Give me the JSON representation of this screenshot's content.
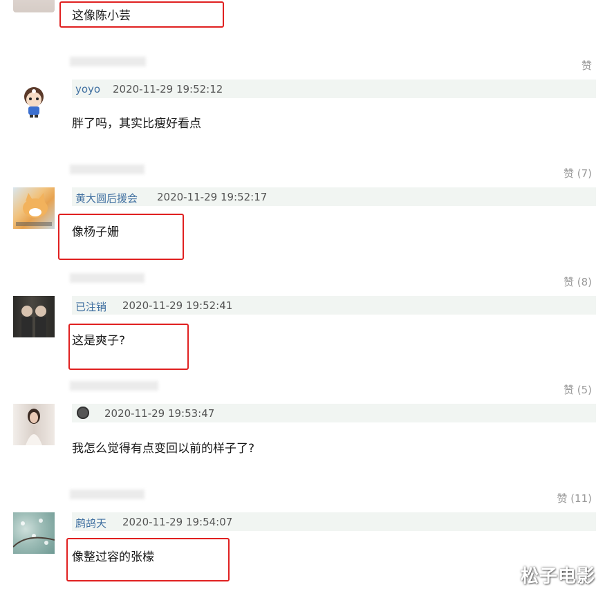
{
  "comments": [
    {
      "text": "这像陈小芸"
    },
    {
      "likes": "赞",
      "user": "yoyo",
      "time": "2020-11-29 19:52:12",
      "text": "胖了吗，其实比瘦好看点"
    },
    {
      "likes": "赞 (7)",
      "user": "黄大圆后援会",
      "time": "2020-11-29 19:52:17",
      "text": "像杨子姗"
    },
    {
      "likes": "赞 (8)",
      "user": "已注销",
      "time": "2020-11-29 19:52:41",
      "text": "这是爽子?"
    },
    {
      "likes": "赞 (5)",
      "user": "",
      "time": "2020-11-29 19:53:47",
      "text": "我怎么觉得有点变回以前的样子了?"
    },
    {
      "likes": "赞 (11)",
      "user": "鹧鸪天",
      "time": "2020-11-29 19:54:07",
      "text": "像整过容的张檬"
    }
  ],
  "watermark": "松子电影",
  "colors": {
    "highlight_box": "#e02020",
    "username": "#3f6fa0",
    "meta_bg": "#f1f5f2"
  }
}
